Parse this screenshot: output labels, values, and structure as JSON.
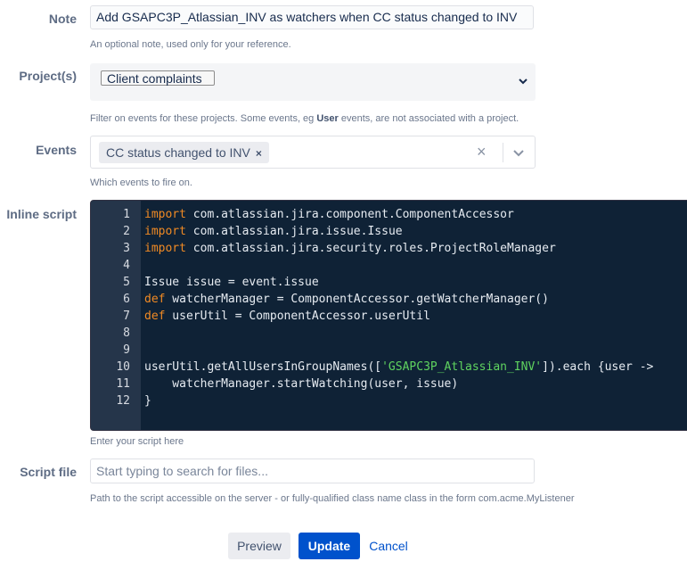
{
  "note": {
    "label": "Note",
    "value": "Add GSAPC3P_Atlassian_INV as watchers when CC status changed to INV",
    "help": "An optional note, used only for your reference."
  },
  "projects": {
    "label": "Project(s)",
    "selected": "Client complaints",
    "help_prefix": "Filter on events for these projects. Some events, eg ",
    "help_bold": "User",
    "help_suffix": " events, are not associated with a project."
  },
  "events": {
    "label": "Events",
    "chip": "CC status changed to INV",
    "chip_remove": "×",
    "clear": "×",
    "help": "Which events to fire on."
  },
  "inline_script": {
    "label": "Inline script",
    "help": "Enter your script here",
    "lines": [
      {
        "n": "1",
        "kw": "import",
        "rest": " com.atlassian.jira.component.ComponentAccessor"
      },
      {
        "n": "2",
        "kw": "import",
        "rest": " com.atlassian.jira.issue.Issue"
      },
      {
        "n": "3",
        "kw": "import",
        "rest": " com.atlassian.jira.security.roles.ProjectRoleManager"
      },
      {
        "n": "4",
        "kw": "",
        "rest": ""
      },
      {
        "n": "5",
        "kw": "",
        "rest": "Issue issue = event.issue"
      },
      {
        "n": "6",
        "kw": "def",
        "rest": " watcherManager = ComponentAccessor.getWatcherManager()"
      },
      {
        "n": "7",
        "kw": "def",
        "rest": " userUtil = ComponentAccessor.userUtil"
      },
      {
        "n": "8",
        "kw": "",
        "rest": ""
      },
      {
        "n": "9",
        "kw": "",
        "rest": ""
      },
      {
        "n": "10",
        "kw": "",
        "pre": "userUtil.getAllUsersInGroupNames([",
        "str": "'GSAPC3P_Atlassian_INV'",
        "post": "]).each {user ->"
      },
      {
        "n": "11",
        "kw": "",
        "rest": "    watcherManager.startWatching(user, issue)"
      },
      {
        "n": "12",
        "kw": "",
        "rest": "}"
      }
    ]
  },
  "script_file": {
    "label": "Script file",
    "placeholder": "Start typing to search for files...",
    "help": "Path to the script accessible on the server - or fully-qualified class name class in the form com.acme.MyListener"
  },
  "buttons": {
    "preview": "Preview",
    "update": "Update",
    "cancel": "Cancel"
  },
  "icons": {
    "project_dropdown": "chevron-down-icon",
    "events_dropdown": "chevron-down-icon",
    "events_clear": "close-icon"
  }
}
